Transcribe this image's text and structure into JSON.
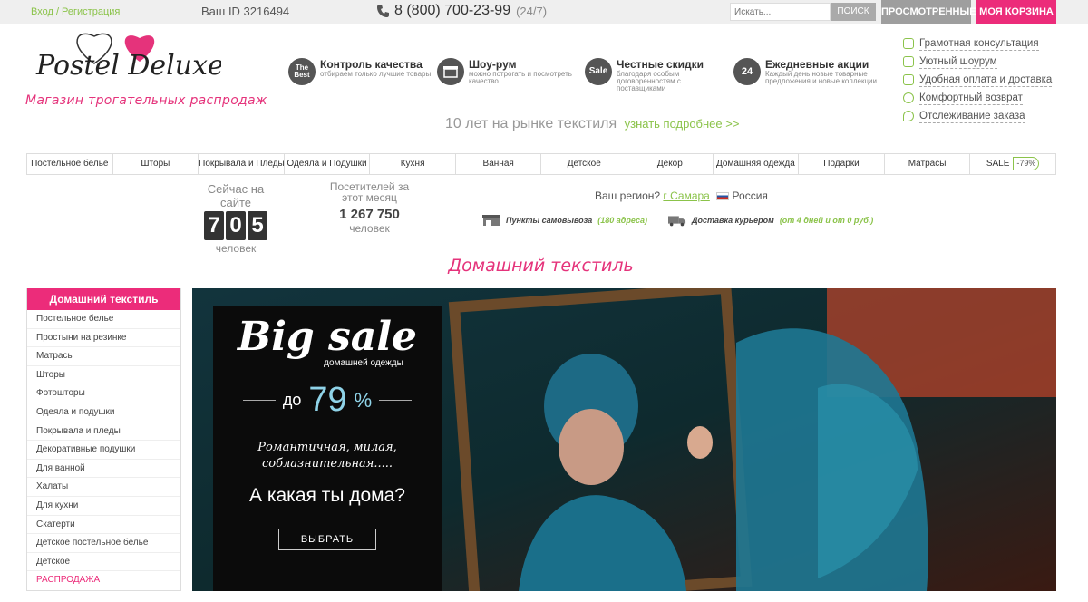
{
  "topbar": {
    "login": "Вход / Регистрация",
    "user_id": "Ваш ID 3216494",
    "phone": "8 (800) 700-23-99",
    "phone_hours": "(24/7)",
    "search_placeholder": "Искать...",
    "search_btn": "ПОИСК",
    "viewed_btn": "ПРОСМОТРЕННЫЕ",
    "cart_btn": "МОЯ КОРЗИНА"
  },
  "brand": {
    "logo_text": "Postel Deluxe",
    "tagline": "Магазин трогательных распродаж",
    "accent": "#ec2c7a",
    "green": "#8bc34a"
  },
  "features": [
    {
      "icon": "The Best",
      "title": "Контроль качества",
      "desc": "отбираем только лучшие товары"
    },
    {
      "icon": "shop-icon",
      "title": "Шоу-рум",
      "desc": "можно потрогать и посмотреть качество"
    },
    {
      "icon": "Sale",
      "title": "Честные скидки",
      "desc": "благодаря особым договоренностям с поставщиками"
    },
    {
      "icon": "24",
      "title": "Ежедневные акции",
      "desc": "Каждый день новые товарные предложения и новые коллекции"
    }
  ],
  "years": {
    "text": "10 лет на рынке текстиля",
    "link": "узнать подробнее >>"
  },
  "services": [
    "Грамотная консультация",
    "Уютный шоурум",
    "Удобная оплата и доставка",
    "Комфортный возврат",
    "Отслеживание заказа"
  ],
  "categories": [
    "Постельное белье",
    "Шторы",
    "Покрывала и Пледы",
    "Одеяла и Подушки",
    "Кухня",
    "Ванная",
    "Детское",
    "Декор",
    "Домашняя одежда",
    "Подарки",
    "Матрасы",
    "SALE"
  ],
  "sale_badge": "-79%",
  "stats": {
    "online_label": "Сейчас на сайте",
    "online_digits": [
      "7",
      "0",
      "5"
    ],
    "online_unit": "человек",
    "monthly_label": "Посетителей за этот месяц",
    "monthly_value": "1 267 750",
    "monthly_unit": "человек"
  },
  "region": {
    "label": "Ваш регион?",
    "city": "г Самара",
    "country": "Россия"
  },
  "pickup": {
    "label": "Пункты самовывоза",
    "count": "(180 адреса)"
  },
  "delivery": {
    "label": "Доставка курьером",
    "terms": "(от 4 дней и от 0 руб.)"
  },
  "section_title": "Домашний текстиль",
  "sidebar": {
    "title": "Домашний текстиль",
    "items": [
      "Постельное белье",
      "Простыни на резинке",
      "Матрасы",
      "Шторы",
      "Фотошторы",
      "Одеяла и подушки",
      "Покрывала и пледы",
      "Декоративные подушки",
      "Для ванной",
      "Халаты",
      "Для кухни",
      "Скатерти",
      "Детское постельное белье",
      "Детское"
    ],
    "sale_item": "РАСПРОДАЖА"
  },
  "banner": {
    "title": "Big sale",
    "subtitle": "домашней одежды",
    "prefix": "до",
    "percent": "79",
    "percent_sign": "%",
    "script": "Романтичная, милая, соблазнительная.....",
    "question": "А какая ты дома?",
    "button": "ВЫБРАТЬ"
  }
}
